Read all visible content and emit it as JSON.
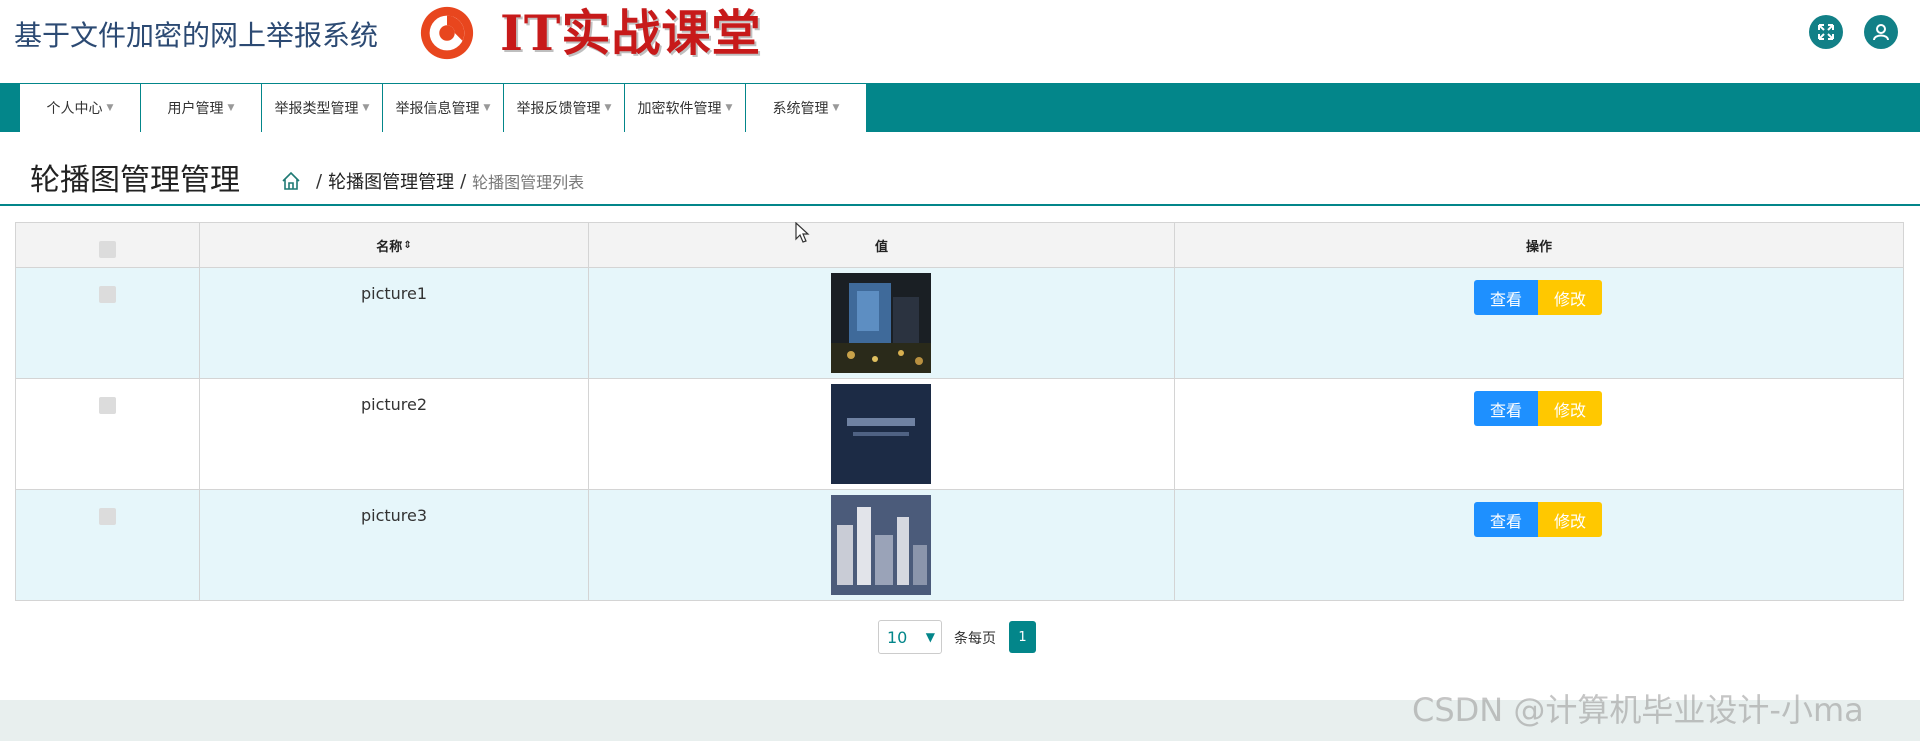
{
  "header": {
    "system_title": "基于文件加密的网上举报系统",
    "brand_text": "IT实战课堂",
    "buttons": [
      {
        "name": "fullscreen-button",
        "icon": "expand-icon"
      },
      {
        "name": "user-button",
        "icon": "user-icon"
      }
    ],
    "accent_color": "#128087"
  },
  "nav": {
    "items": [
      {
        "label": "个人中心"
      },
      {
        "label": "用户管理"
      },
      {
        "label": "举报类型管理"
      },
      {
        "label": "举报信息管理"
      },
      {
        "label": "举报反馈管理"
      },
      {
        "label": "加密软件管理"
      },
      {
        "label": "系统管理"
      }
    ],
    "bar_color": "#03868a"
  },
  "page": {
    "title": "轮播图管理管理",
    "breadcrumb": {
      "home_icon": "home-icon",
      "sep": "/",
      "level1": "轮播图管理管理",
      "level2": "轮播图管理列表"
    }
  },
  "table": {
    "columns": {
      "name": "名称",
      "value": "值",
      "ops": "操作"
    },
    "rows": [
      {
        "name": "picture1",
        "thumb": "night-building-photo",
        "view_label": "查看",
        "edit_label": "修改"
      },
      {
        "name": "picture2",
        "thumb": "dark-blue-poster",
        "view_label": "查看",
        "edit_label": "修改"
      },
      {
        "name": "picture3",
        "thumb": "city-skyline-photo",
        "view_label": "查看",
        "edit_label": "修改"
      }
    ],
    "view_color": "#1e90ff",
    "edit_color": "#ffc800"
  },
  "pagination": {
    "page_size": "10",
    "per_page_label": "条每页",
    "current_page": "1"
  },
  "watermark": "CSDN @计算机毕业设计-小ma"
}
